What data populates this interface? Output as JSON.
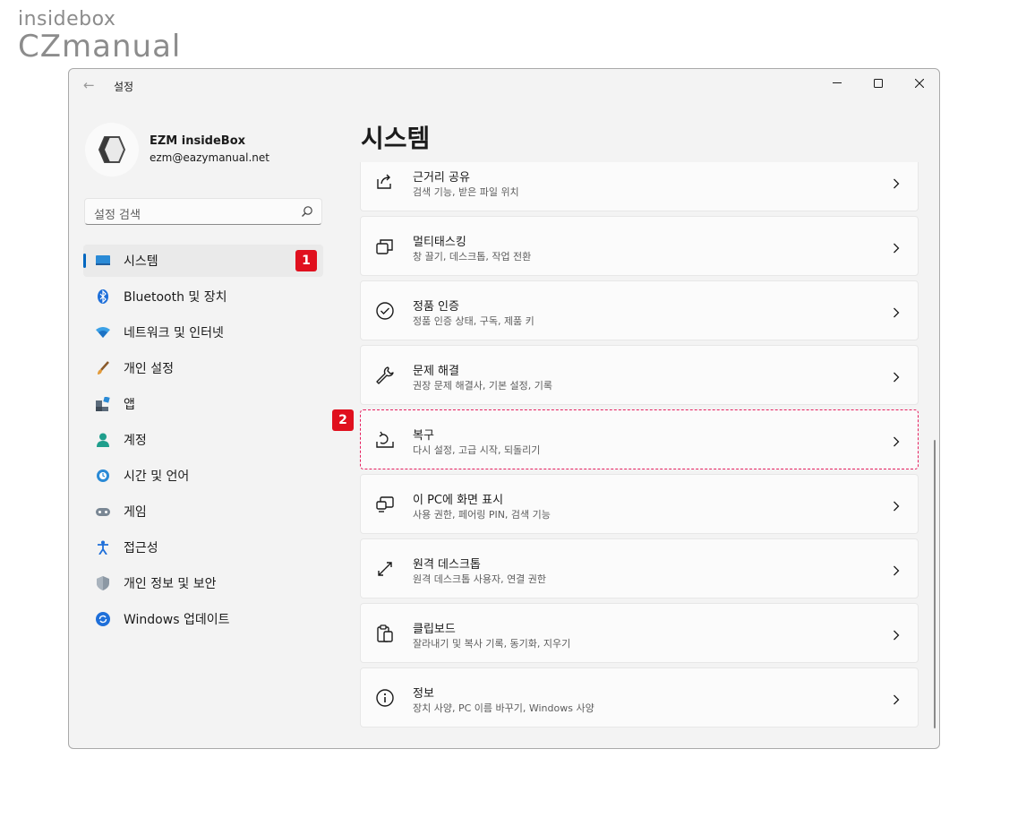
{
  "watermark": {
    "top": "insidebox",
    "bottom": "CZmanual"
  },
  "window": {
    "title": "설정",
    "controls": {
      "minimize": "—",
      "maximize": "☐",
      "close": "✕"
    }
  },
  "profile": {
    "name": "EZM insideBox",
    "email": "ezm@eazymanual.net"
  },
  "search": {
    "placeholder": "설정 검색"
  },
  "nav": {
    "items": [
      {
        "label": "시스템",
        "icon": "system-icon",
        "selected": true
      },
      {
        "label": "Bluetooth 및 장치",
        "icon": "bluetooth-icon"
      },
      {
        "label": "네트워크 및 인터넷",
        "icon": "wifi-icon"
      },
      {
        "label": "개인 설정",
        "icon": "brush-icon"
      },
      {
        "label": "앱",
        "icon": "apps-icon"
      },
      {
        "label": "계정",
        "icon": "account-icon"
      },
      {
        "label": "시간 및 언어",
        "icon": "time-language-icon"
      },
      {
        "label": "게임",
        "icon": "gamepad-icon"
      },
      {
        "label": "접근성",
        "icon": "accessibility-icon"
      },
      {
        "label": "개인 정보 및 보안",
        "icon": "shield-icon"
      },
      {
        "label": "Windows 업데이트",
        "icon": "update-icon"
      }
    ]
  },
  "content": {
    "title": "시스템",
    "cards": [
      {
        "title": "근거리 공유",
        "subtitle": "검색 기능, 받은 파일 위치",
        "icon": "share-icon"
      },
      {
        "title": "멀티태스킹",
        "subtitle": "창 끌기, 데스크톱, 작업 전환",
        "icon": "multitasking-icon"
      },
      {
        "title": "정품 인증",
        "subtitle": "정품 인증 상태, 구독, 제품 키",
        "icon": "check-circle-icon"
      },
      {
        "title": "문제 해결",
        "subtitle": "권장 문제 해결사, 기본 설정, 기록",
        "icon": "wrench-icon"
      },
      {
        "title": "복구",
        "subtitle": "다시 설정, 고급 시작, 되돌리기",
        "icon": "recovery-icon",
        "highlighted": true
      },
      {
        "title": "이 PC에 화면 표시",
        "subtitle": "사용 권한, 페어링 PIN, 검색 기능",
        "icon": "project-icon"
      },
      {
        "title": "원격 데스크톱",
        "subtitle": "원격 데스크톱 사용자, 연결 권한",
        "icon": "remote-desktop-icon"
      },
      {
        "title": "클립보드",
        "subtitle": "잘라내기 및 복사 기록, 동기화, 지우기",
        "icon": "clipboard-icon"
      },
      {
        "title": "정보",
        "subtitle": "장치 사양, PC 이름 바꾸기, Windows 사양",
        "icon": "info-icon"
      }
    ]
  },
  "annotations": {
    "step1": "1",
    "step2": "2"
  },
  "colors": {
    "accent": "#0067c0",
    "badge": "#e0101e",
    "highlight": "#e6205f"
  }
}
